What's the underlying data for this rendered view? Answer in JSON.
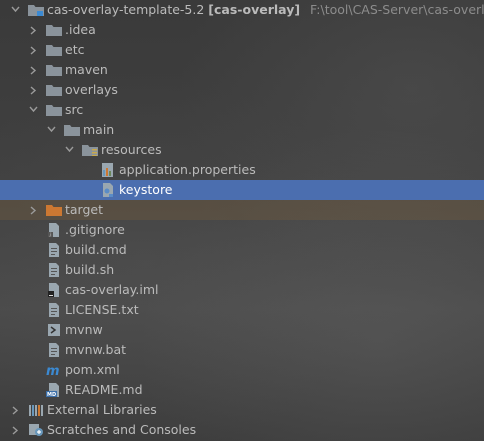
{
  "tree": {
    "root": {
      "name": "cas-overlay-template-5.2",
      "module": "[cas-overlay]",
      "path": "F:\\tool\\CAS-Server\\cas-overlay-te"
    },
    "items": [
      {
        "label": "cas-overlay-template-5.2"
      },
      {
        "label": ".idea"
      },
      {
        "label": "etc"
      },
      {
        "label": "maven"
      },
      {
        "label": "overlays"
      },
      {
        "label": "src"
      },
      {
        "label": "main"
      },
      {
        "label": "resources"
      },
      {
        "label": "application.properties"
      },
      {
        "label": "keystore"
      },
      {
        "label": "target"
      },
      {
        "label": ".gitignore"
      },
      {
        "label": "build.cmd"
      },
      {
        "label": "build.sh"
      },
      {
        "label": "cas-overlay.iml"
      },
      {
        "label": "LICENSE.txt"
      },
      {
        "label": "mvnw"
      },
      {
        "label": "mvnw.bat"
      },
      {
        "label": "pom.xml"
      },
      {
        "label": "README.md"
      },
      {
        "label": "External Libraries"
      },
      {
        "label": "Scratches and Consoles"
      }
    ]
  },
  "colors": {
    "folder": "#8a939b",
    "target_folder": "#cc7832",
    "selection": "#4b6eaf",
    "maven_blue": "#3b8ad3"
  }
}
